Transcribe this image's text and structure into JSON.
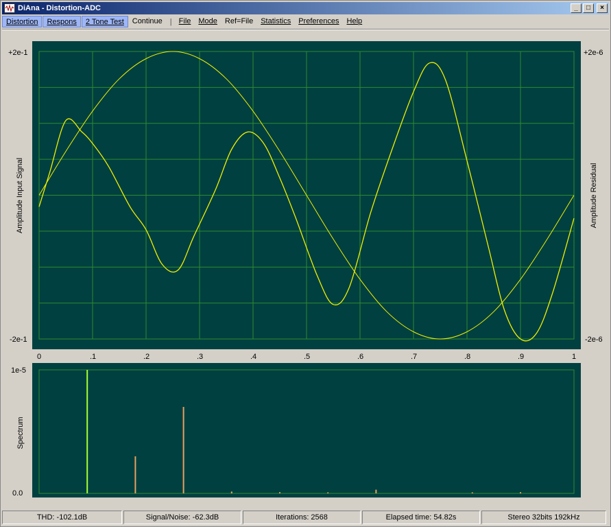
{
  "window": {
    "title": "DiAna - Distortion-ADC",
    "buttons": {
      "minimize": "_",
      "maximize": "□",
      "close": "×"
    }
  },
  "menu": {
    "tabs": [
      "Distortion",
      "Respons",
      "2 Tone Test"
    ],
    "continue": "Continue",
    "separator": "|",
    "items": [
      "File",
      "Mode",
      "Ref=File",
      "Statistics",
      "Preferences",
      "Help"
    ]
  },
  "colors": {
    "plot_bg": "#004040",
    "grid": "#2f8a2f",
    "waveform": "#f0f000",
    "fundamental_bar": "#aaff33",
    "harmonic_bar": "#e8a060"
  },
  "chart_data": [
    {
      "type": "line",
      "ylabel": "Amplitude Input Signal",
      "ylabel_right": "Amplitude Residual",
      "y_ticks_left": {
        "top": "+2e-1",
        "bottom": "-2e-1"
      },
      "y_ticks_right": {
        "top": "+2e-6",
        "bottom": "-2e-6"
      },
      "xlim": [
        0,
        1
      ],
      "x_ticks": [
        "0",
        ".1",
        ".2",
        ".3",
        ".4",
        ".5",
        ".6",
        ".7",
        ".8",
        ".9",
        "1"
      ],
      "grid": true,
      "series": [
        {
          "axis": "left",
          "x": [
            0,
            0.05,
            0.1,
            0.15,
            0.2,
            0.25,
            0.3,
            0.35,
            0.4,
            0.45,
            0.5,
            0.55,
            0.6,
            0.65,
            0.7,
            0.75,
            0.8,
            0.85,
            0.9,
            0.95,
            1.0
          ],
          "y": [
            0.0,
            0.061,
            0.117,
            0.162,
            0.19,
            0.2,
            0.19,
            0.162,
            0.117,
            0.061,
            0.0,
            -0.061,
            -0.117,
            -0.162,
            -0.19,
            -0.2,
            -0.19,
            -0.162,
            -0.117,
            -0.061,
            0.0
          ]
        },
        {
          "axis": "right",
          "x": [
            0,
            0.02,
            0.05,
            0.08,
            0.1,
            0.13,
            0.17,
            0.2,
            0.23,
            0.26,
            0.29,
            0.33,
            0.36,
            0.39,
            0.42,
            0.45,
            0.48,
            0.52,
            0.55,
            0.58,
            0.62,
            0.66,
            0.7,
            0.73,
            0.76,
            0.8,
            0.84,
            0.87,
            0.9,
            0.93,
            0.96,
            1.0
          ],
          "y": [
            -0.2,
            0.4,
            1.3,
            1.1,
            0.9,
            0.5,
            -0.2,
            -0.6,
            -1.2,
            -1.3,
            -0.7,
            0.1,
            0.8,
            1.1,
            0.9,
            0.3,
            -0.4,
            -1.4,
            -1.9,
            -1.6,
            -0.3,
            0.8,
            1.8,
            2.3,
            2.0,
            0.6,
            -0.9,
            -2.0,
            -2.5,
            -2.4,
            -1.7,
            -0.4
          ]
        }
      ]
    },
    {
      "type": "bar",
      "ylabel": "Spectrum",
      "y_ticks": {
        "top": "1e-5",
        "bottom": "0.0"
      },
      "ylim": [
        0,
        10
      ],
      "grid": false,
      "bars": [
        {
          "x": 0.09,
          "value": 10.0,
          "kind": "fundamental"
        },
        {
          "x": 0.18,
          "value": 3.0,
          "kind": "harmonic"
        },
        {
          "x": 0.27,
          "value": 7.0,
          "kind": "harmonic"
        },
        {
          "x": 0.36,
          "value": 0.15,
          "kind": "harmonic"
        },
        {
          "x": 0.45,
          "value": 0.1,
          "kind": "harmonic"
        },
        {
          "x": 0.54,
          "value": 0.08,
          "kind": "harmonic"
        },
        {
          "x": 0.63,
          "value": 0.3,
          "kind": "harmonic"
        },
        {
          "x": 0.81,
          "value": 0.08,
          "kind": "harmonic"
        },
        {
          "x": 0.9,
          "value": 0.1,
          "kind": "harmonic"
        }
      ]
    }
  ],
  "status": {
    "thd": "THD: -102.1dB",
    "snr": "Signal/Noise:  -62.3dB",
    "iterations": "Iterations: 2568",
    "elapsed": "Elapsed time: 54.82s",
    "format": "Stereo 32bits 192kHz"
  }
}
